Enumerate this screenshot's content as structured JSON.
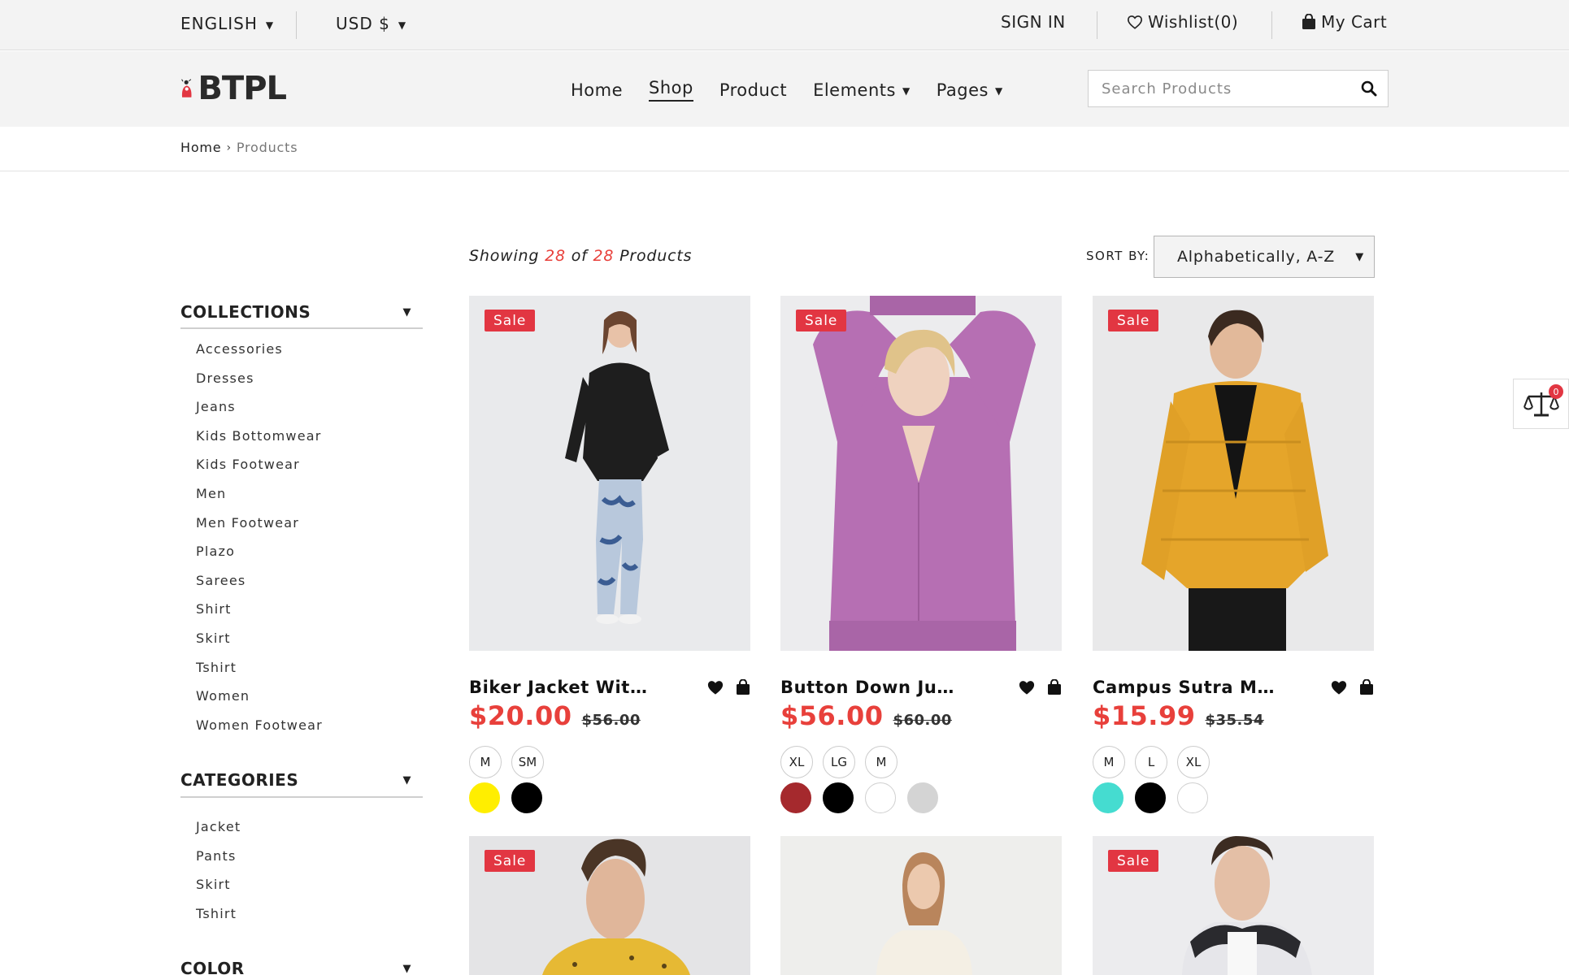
{
  "topbar": {
    "language": "ENGLISH",
    "currency": "USD $",
    "sign_in": "SIGN IN",
    "wishlist": "Wishlist(0)",
    "cart": "My Cart"
  },
  "header": {
    "logo_text": "BTPL",
    "nav": [
      {
        "label": "Home"
      },
      {
        "label": "Shop"
      },
      {
        "label": "Product"
      },
      {
        "label": "Elements"
      },
      {
        "label": "Pages"
      }
    ],
    "search_placeholder": "Search Products"
  },
  "breadcrumb": {
    "home": "Home",
    "current": "Products"
  },
  "sidebar": {
    "collections_title": "COLLECTIONS",
    "collections": [
      "Accessories",
      "Dresses",
      "Jeans",
      "Kids Bottomwear",
      "Kids Footwear",
      "Men",
      "Men Footwear",
      "Plazo",
      "Sarees",
      "Shirt",
      "Skirt",
      "Tshirt",
      "Women",
      "Women Footwear"
    ],
    "categories_title": "CATEGORIES",
    "categories": [
      "Jacket",
      "Pants",
      "Skirt",
      "Tshirt"
    ],
    "color_title": "COLOR"
  },
  "toolbar": {
    "showing_prefix": "Showing",
    "showing_count": "28",
    "showing_of": "of",
    "showing_total": "28",
    "showing_suffix": "Products",
    "sort_label": "SORT BY:",
    "sort_value": "Alphabetically, A-Z"
  },
  "products": [
    {
      "name": "Biker Jacket With...",
      "price": "$20.00",
      "old_price": "$56.00",
      "sale": "Sale",
      "sizes": [
        "M",
        "SM"
      ],
      "colors": [
        "#ffee00",
        "#000000"
      ]
    },
    {
      "name": "Button Down Jumper",
      "price": "$56.00",
      "old_price": "$60.00",
      "sale": "Sale",
      "sizes": [
        "XL",
        "LG",
        "M"
      ],
      "colors": [
        "#a5292d",
        "#000000",
        "#ffffff",
        "#d4d4d4"
      ]
    },
    {
      "name": "Campus Sutra Men...",
      "price": "$15.99",
      "old_price": "$35.54",
      "sale": "Sale",
      "sizes": [
        "M",
        "L",
        "XL"
      ],
      "colors": [
        "#45dcd0",
        "#000000",
        "#ffffff"
      ]
    },
    {
      "sale": "Sale"
    },
    {},
    {
      "sale": "Sale"
    }
  ],
  "compare": {
    "count": "0"
  },
  "colors": {
    "accent": "#e8403b",
    "sale_badge": "#e23642",
    "bar_bg": "#f3f3f3"
  }
}
